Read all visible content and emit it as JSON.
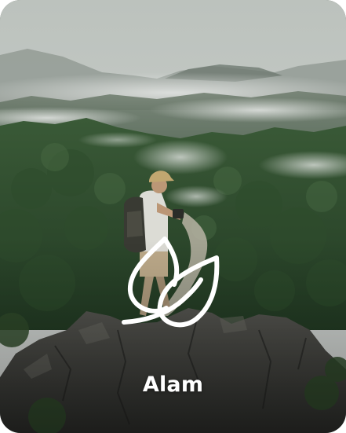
{
  "category_card": {
    "label": "Alam",
    "icon": "leaf-icon",
    "label_color": "#ffffff",
    "icon_color": "#ffffff"
  }
}
